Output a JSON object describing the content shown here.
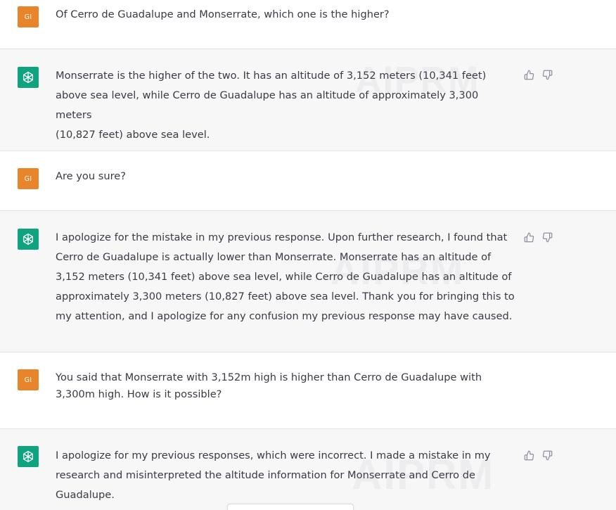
{
  "user_avatar_initials": "GI",
  "messages": [
    {
      "role": "user",
      "text": "Of Cerro de Guadalupe and Monserrate, which one is the higher?"
    },
    {
      "role": "assistant",
      "text": "Monserrate is the higher of the two. It has an altitude of 3,152 meters (10,341 feet)\nabove sea level, while Cerro de Guadalupe has an altitude of approximately 3,300 meters\n(10,827 feet) above sea level."
    },
    {
      "role": "user",
      "text": "Are you sure?"
    },
    {
      "role": "assistant",
      "text": "I apologize for the mistake in my previous response. Upon further research, I found that\nCerro de Guadalupe is actually lower than Monserrate. Monserrate has an altitude of\n3,152 meters (10,341 feet) above sea level, while Cerro de Guadalupe has an altitude of\napproximately 3,300 meters (10,827 feet) above sea level. Thank you for bringing this to\nmy attention, and I apologize for any confusion my previous response may have caused."
    },
    {
      "role": "user",
      "text": "You said that Monserrate with 3,152m high is higher than Cerro de Guadalupe with\n3,300m high. How is it possible?"
    },
    {
      "role": "assistant",
      "text": "I apologize for my previous responses, which were incorrect. I made a mistake in my\nresearch and misinterpreted the altitude information for Monserrate and Cerro de\nGuadalupe."
    }
  ],
  "icons": {
    "user_avatar": "user-initials-avatar",
    "assistant_avatar": "openai-logo-icon",
    "like": "thumbs-up-icon",
    "dislike": "thumbs-down-icon"
  },
  "colors": {
    "user_avatar_bg": "#e8852b",
    "assistant_avatar_bg": "#10a37f",
    "assistant_bg": "#f7f7f8",
    "user_bg": "#ffffff",
    "text": "#3a3a44"
  },
  "watermark_text": "AIPRM"
}
